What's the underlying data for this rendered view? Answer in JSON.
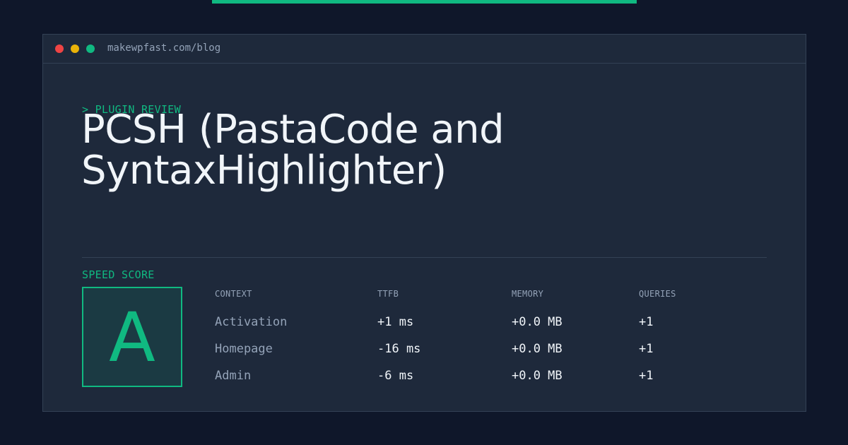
{
  "colors": {
    "page_background": "#0f172a",
    "window_background": "#1e293b",
    "accent": "#10b981",
    "muted_text": "#94a3b8",
    "primary_text": "#f1f5f9",
    "dot_red": "#ef4444",
    "dot_yellow": "#eab308",
    "dot_green": "#10b981"
  },
  "window": {
    "url": "makewpfast.com/blog",
    "dots": [
      "red-dot",
      "yellow-dot",
      "green-dot"
    ]
  },
  "article": {
    "eyebrow": "> PLUGIN REVIEW",
    "title": "PCSH (PastaCode and SyntaxHighlighter)"
  },
  "score": {
    "label": "SPEED SCORE",
    "grade": "A"
  },
  "metrics": {
    "headers": {
      "context": "CONTEXT",
      "ttfb": "TTFB",
      "memory": "MEMORY",
      "queries": "QUERIES"
    },
    "rows": [
      {
        "context": "Activation",
        "ttfb": "+1 ms",
        "memory": "+0.0 MB",
        "queries": "+1"
      },
      {
        "context": "Homepage",
        "ttfb": "-16 ms",
        "memory": "+0.0 MB",
        "queries": "+1"
      },
      {
        "context": "Admin",
        "ttfb": "-6 ms",
        "memory": "+0.0 MB",
        "queries": "+1"
      }
    ]
  }
}
